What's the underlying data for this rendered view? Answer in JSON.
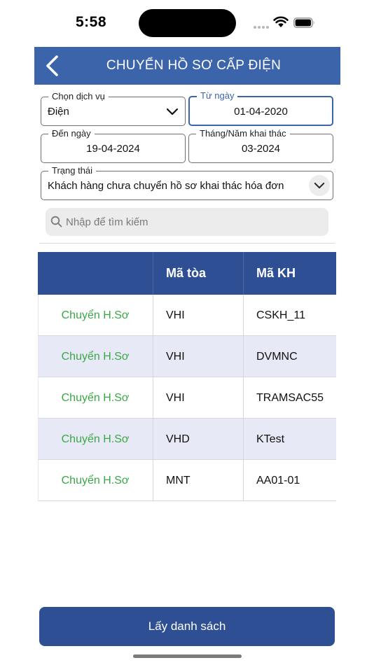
{
  "status_bar": {
    "time": "5:58"
  },
  "header": {
    "title": "CHUYỂN HỒ SƠ CẤP ĐIỆN"
  },
  "filters": {
    "service": {
      "label": "Chọn dịch vụ",
      "value": "Điện"
    },
    "from_date": {
      "label": "Từ ngày",
      "value": "01-04-2020"
    },
    "to_date": {
      "label": "Đến ngày",
      "value": "19-04-2024"
    },
    "month_year": {
      "label": "Tháng/Năm khai thác",
      "value": "03-2024"
    },
    "status": {
      "label": "Trạng thái",
      "value": "Khách hàng chưa chuyển hồ sơ khai thác hóa đơn"
    }
  },
  "search": {
    "placeholder": "Nhập để tìm kiếm"
  },
  "table": {
    "columns": [
      "",
      "Mã tòa",
      "Mã KH"
    ],
    "rows": [
      {
        "action": "Chuyển H.Sơ",
        "building": "VHI",
        "customer": "CSKH_11"
      },
      {
        "action": "Chuyển H.Sơ",
        "building": "VHI",
        "customer": "DVMNC"
      },
      {
        "action": "Chuyển H.Sơ",
        "building": "VHI",
        "customer": "TRAMSAC55"
      },
      {
        "action": "Chuyển H.Sơ",
        "building": "VHD",
        "customer": "KTest"
      },
      {
        "action": "Chuyển H.Sơ",
        "building": "MNT",
        "customer": "AA01-01"
      }
    ]
  },
  "footer": {
    "submit_label": "Lấy danh sách"
  },
  "colors": {
    "header_bg": "#3c64ab",
    "table_header_bg": "#2f4f94",
    "action_text": "#3aa846",
    "alt_row_bg": "#e8e9f6",
    "button_bg": "#2f4f94"
  }
}
